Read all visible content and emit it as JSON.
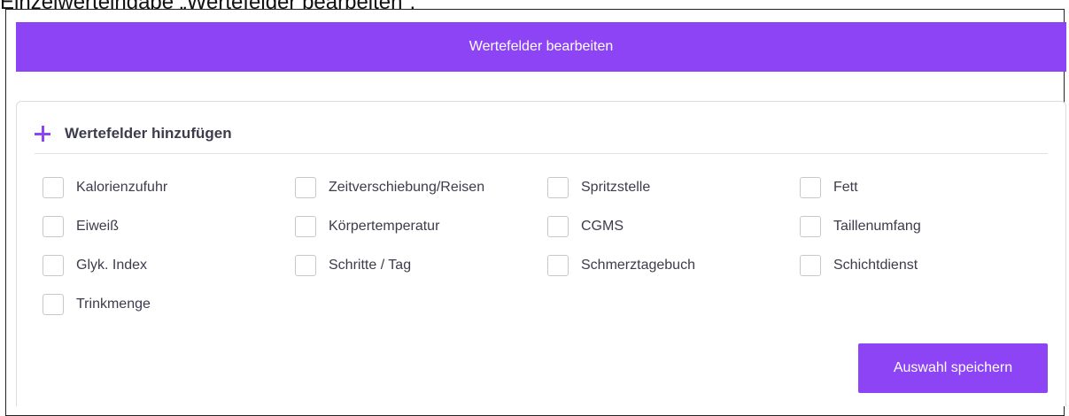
{
  "caption": "Einzelwerteingabe „Wertefelder bearbeiten“:",
  "edit_bar": {
    "label": "Wertefelder bearbeiten"
  },
  "card": {
    "header": {
      "label": "Wertefelder hinzufügen",
      "icon": "plus-icon"
    },
    "options": [
      {
        "label": "Kalorienzufuhr",
        "checked": false
      },
      {
        "label": "Zeitverschiebung/Reisen",
        "checked": false
      },
      {
        "label": "Spritzstelle",
        "checked": false
      },
      {
        "label": "Fett",
        "checked": false
      },
      {
        "label": "Eiweiß",
        "checked": false
      },
      {
        "label": "Körpertemperatur",
        "checked": false
      },
      {
        "label": "CGMS",
        "checked": false
      },
      {
        "label": "Taillenumfang",
        "checked": false
      },
      {
        "label": "Glyk. Index",
        "checked": false
      },
      {
        "label": "Schritte / Tag",
        "checked": false
      },
      {
        "label": "Schmerztagebuch",
        "checked": false
      },
      {
        "label": "Schichtdienst",
        "checked": false
      },
      {
        "label": "Trinkmenge",
        "checked": false
      }
    ],
    "save_label": "Auswahl speichern"
  },
  "colors": {
    "accent": "#8c44f5",
    "text": "#3c3c4c"
  }
}
